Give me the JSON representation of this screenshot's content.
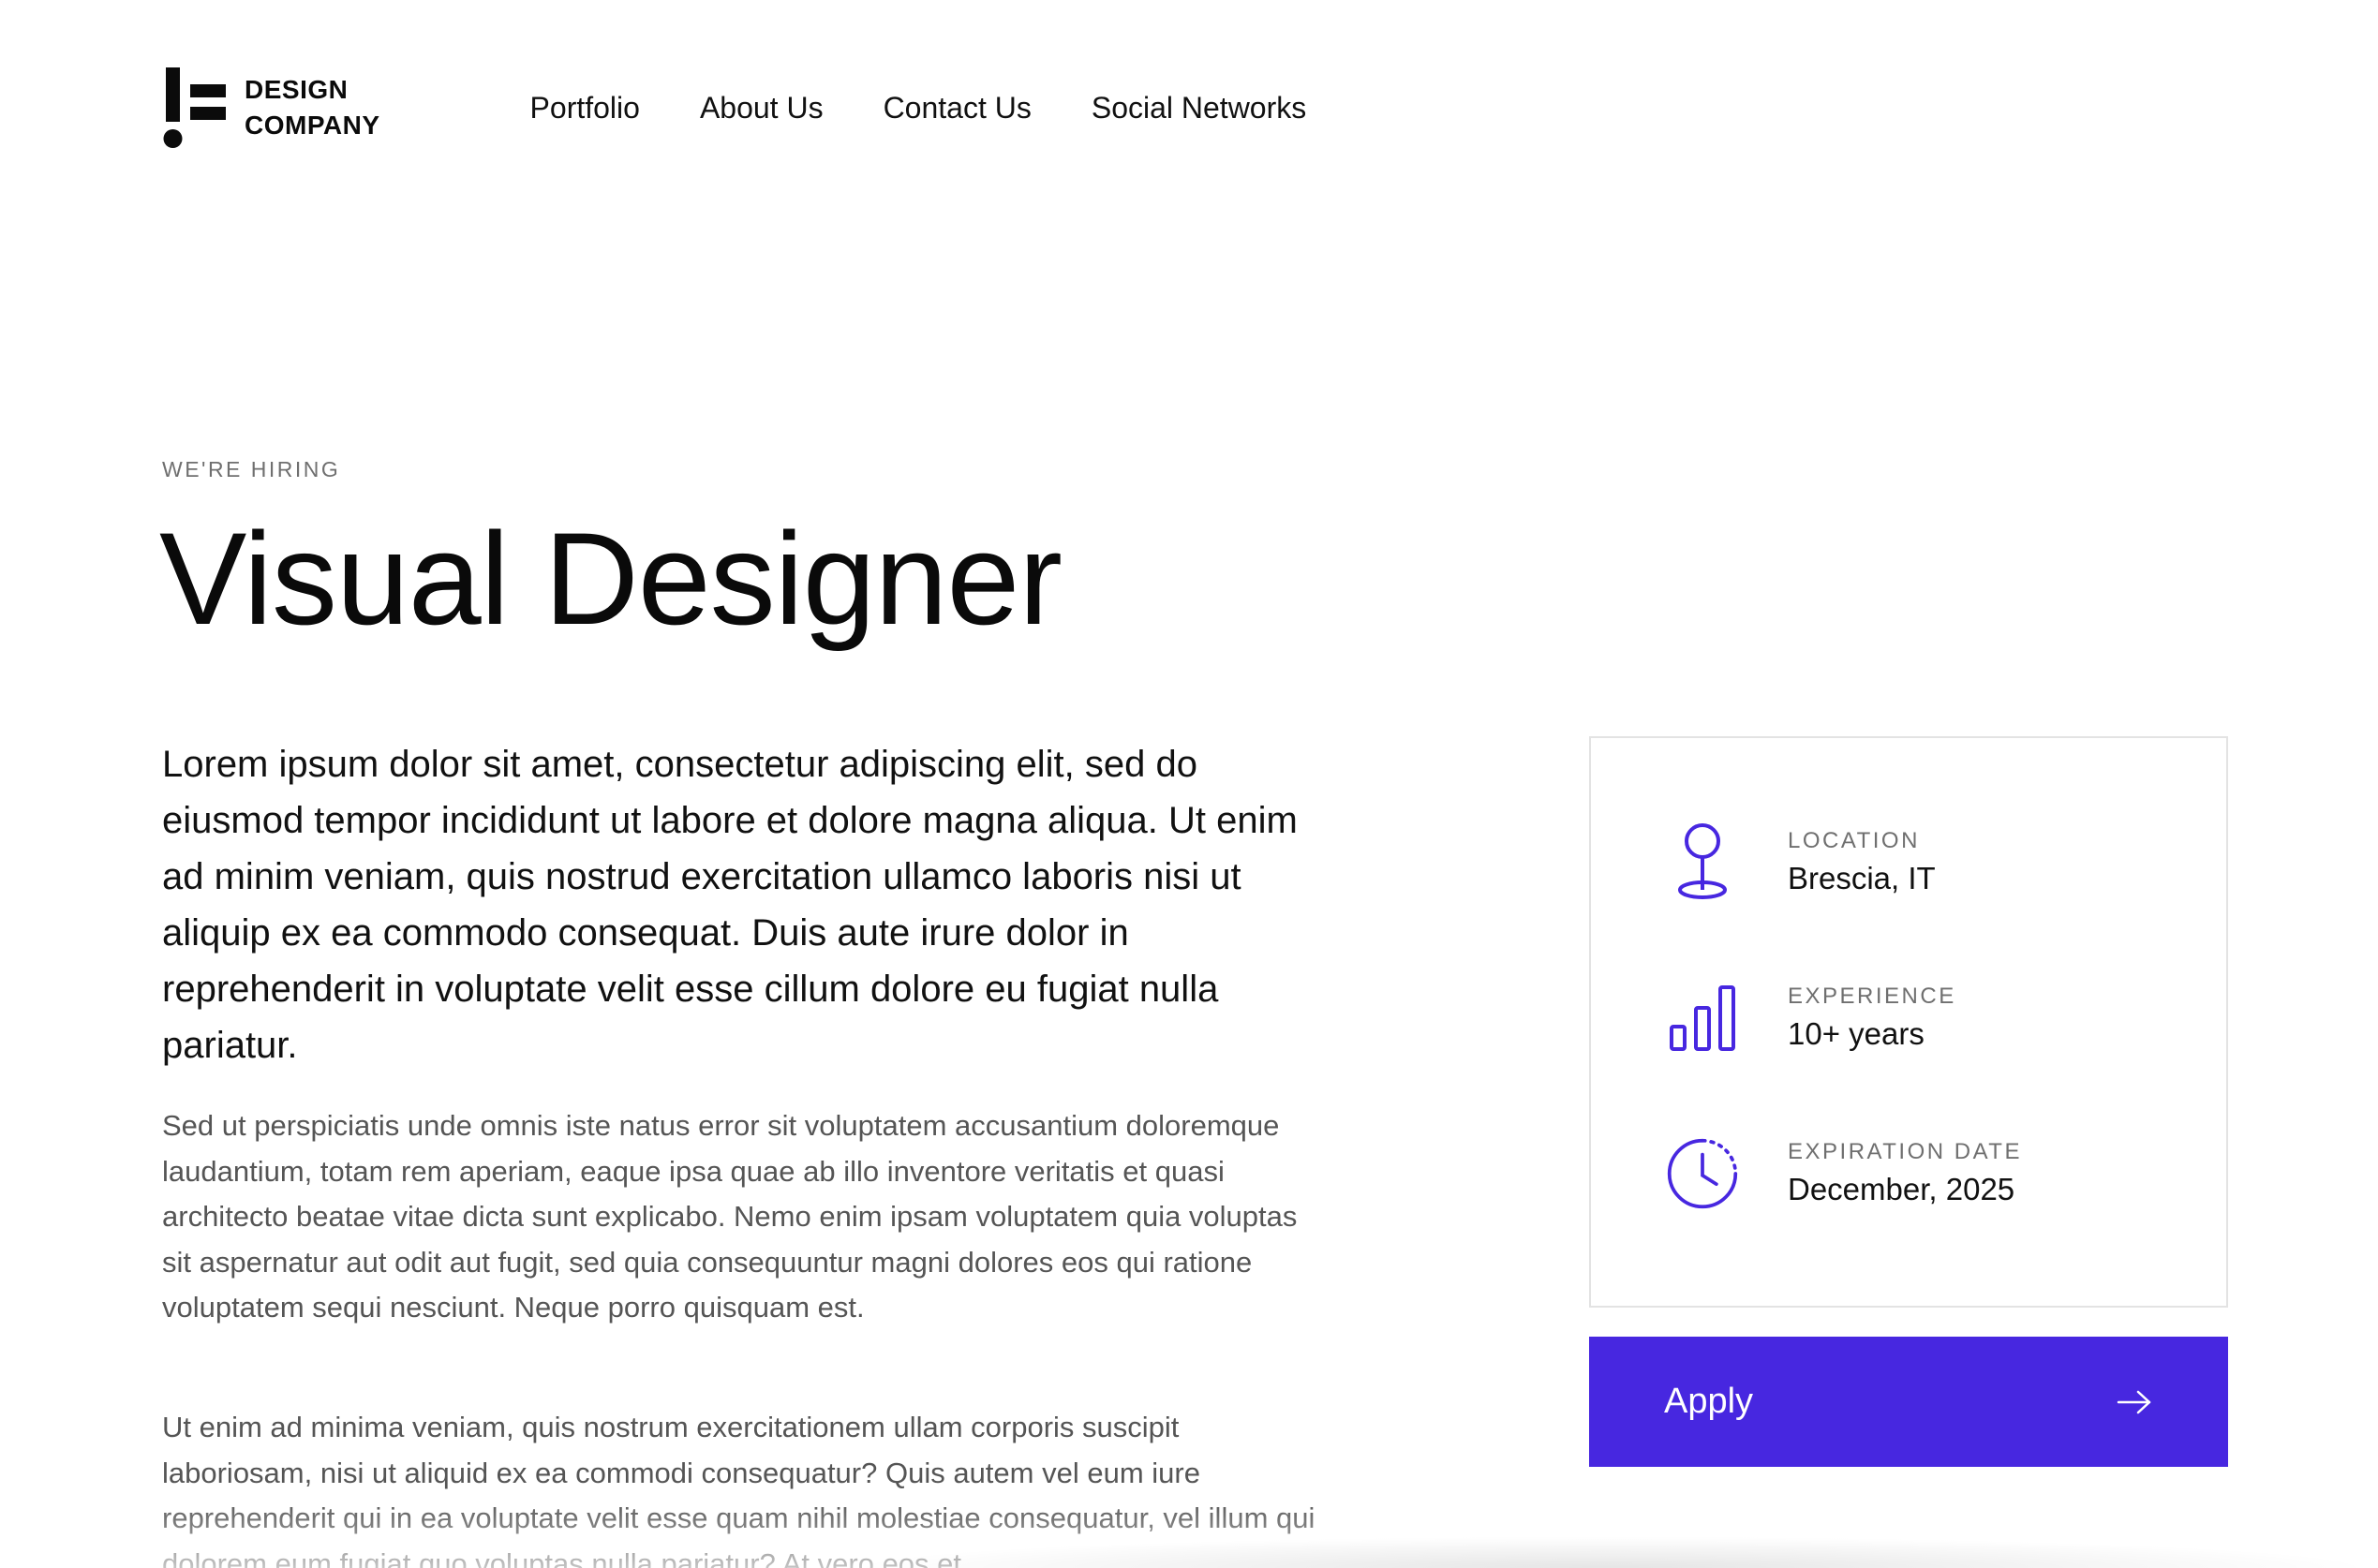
{
  "brand": {
    "line1": "DESIGN",
    "line2": "COMPANY"
  },
  "nav": [
    {
      "label": "Portfolio"
    },
    {
      "label": "About Us"
    },
    {
      "label": "Contact Us"
    },
    {
      "label": "Social Networks"
    }
  ],
  "hero": {
    "eyebrow": "WE'RE HIRING",
    "title": "Visual Designer"
  },
  "content": {
    "lead": "Lorem ipsum dolor sit amet, consectetur adipiscing elit, sed do eiusmod tempor incididunt ut labore et dolore magna aliqua. Ut enim ad minim veniam, quis nostrud exercitation ullamco laboris nisi ut aliquip ex ea commodo consequat. Duis aute irure dolor in reprehenderit in voluptate velit esse cillum dolore eu fugiat nulla pariatur.",
    "para1": "Sed ut perspiciatis unde omnis iste natus error sit voluptatem accusantium doloremque laudantium, totam rem aperiam, eaque ipsa quae ab illo inventore veritatis et quasi architecto beatae vitae dicta sunt explicabo. Nemo enim ipsam voluptatem quia voluptas sit aspernatur aut odit aut fugit, sed quia consequuntur magni dolores eos qui ratione voluptatem sequi nesciunt. Neque porro quisquam est.",
    "para2": "Ut enim ad minima veniam, quis nostrum exercitationem ullam corporis suscipit laboriosam, nisi ut aliquid ex ea commodi consequatur? Quis autem vel eum iure reprehenderit qui in ea voluptate velit esse quam nihil molestiae consequatur, vel illum qui dolorem eum fugiat quo voluptas nulla pariatur? At vero eos et"
  },
  "details": {
    "location": {
      "label": "LOCATION",
      "value": "Brescia, IT",
      "icon": "map-pin-icon"
    },
    "experience": {
      "label": "EXPERIENCE",
      "value": "10+ years",
      "icon": "bar-chart-icon"
    },
    "expiration": {
      "label": "EXPIRATION DATE",
      "value": "December, 2025",
      "icon": "clock-icon"
    }
  },
  "apply": {
    "label": "Apply",
    "icon": "arrow-right-icon"
  },
  "colors": {
    "accent": "#4727e0",
    "muted": "#6f6f6f",
    "text": "#111111",
    "border": "#e3e3e3"
  }
}
